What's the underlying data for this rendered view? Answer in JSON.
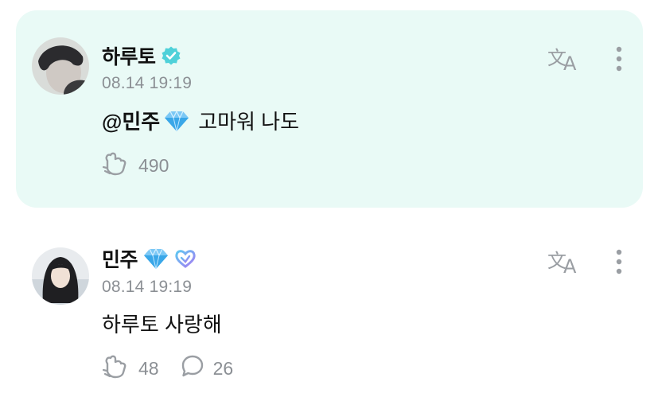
{
  "colors": {
    "highlight_bg": "#e9faf6",
    "verified": "#4fd1d9",
    "muted": "#8b8f94",
    "icon": "#9a9ea3"
  },
  "comments": [
    {
      "author": "하루토",
      "verified": true,
      "time": "08.14 19:19",
      "mention": "@민주",
      "mention_emoji": "diamond",
      "text": "고마워 나도",
      "reaction_count": "490",
      "reply_count": null,
      "highlighted": true
    },
    {
      "author": "민주",
      "author_emoji": "diamond",
      "badge": "heart-badge",
      "time": "08.14 19:19",
      "text": "하루토 사랑해",
      "reaction_count": "48",
      "reply_count": "26",
      "highlighted": false
    }
  ],
  "icons": {
    "translate": "translate-icon",
    "more": "more-vertical-icon",
    "reaction": "heart-hand-icon",
    "reply": "speech-bubble-icon"
  }
}
